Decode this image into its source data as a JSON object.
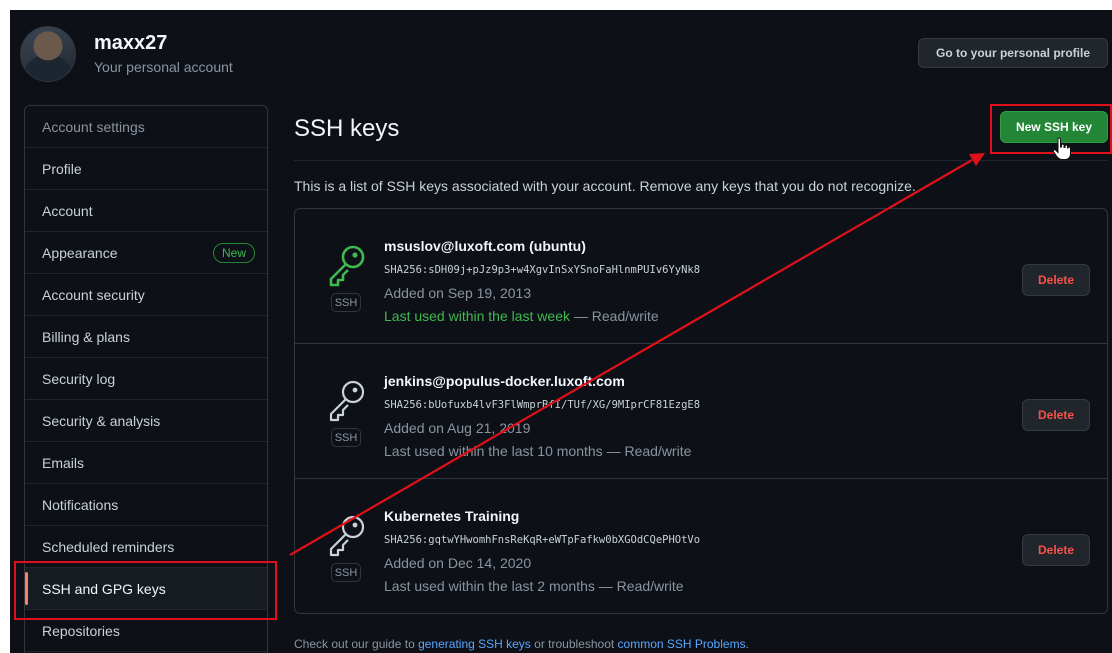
{
  "header": {
    "username": "maxx27",
    "account_sub": "Your personal account",
    "profile_button": "Go to your personal profile"
  },
  "sidebar": {
    "items": [
      {
        "label": "Account settings",
        "type": "heading"
      },
      {
        "label": "Profile"
      },
      {
        "label": "Account"
      },
      {
        "label": "Appearance",
        "badge": "New"
      },
      {
        "label": "Account security"
      },
      {
        "label": "Billing & plans"
      },
      {
        "label": "Security log"
      },
      {
        "label": "Security & analysis"
      },
      {
        "label": "Emails"
      },
      {
        "label": "Notifications"
      },
      {
        "label": "Scheduled reminders"
      },
      {
        "label": "SSH and GPG keys",
        "selected": true
      },
      {
        "label": "Repositories"
      }
    ]
  },
  "main": {
    "title": "SSH keys",
    "new_key_button": "New SSH key",
    "intro": "This is a list of SSH keys associated with your account. Remove any keys that you do not recognize.",
    "keys": [
      {
        "title": "msuslov@luxoft.com (ubuntu)",
        "fingerprint": "SHA256:sDH09j+pJz9p3+w4XgvInSxYSnoFaHlnmPUIv6YyNk8",
        "added": "Added on Sep 19, 2013",
        "used_recent": "Last used within the last week",
        "used_suffix": " — Read/write",
        "tag": "SSH",
        "delete_label": "Delete",
        "active": true
      },
      {
        "title": "jenkins@populus-docker.luxoft.com",
        "fingerprint": "SHA256:bUofuxb4lvF3FlWmprBfI/TUf/XG/9MIprCF81EzgE8",
        "added": "Added on Aug 21, 2019",
        "used_recent": "",
        "used_suffix": "Last used within the last 10 months — Read/write",
        "tag": "SSH",
        "delete_label": "Delete",
        "active": false
      },
      {
        "title": "Kubernetes Training",
        "fingerprint": "SHA256:gqtwYHwomhFnsReKqR+eWTpFafkw0bXGOdCQePHOtVo",
        "added": "Added on Dec 14, 2020",
        "used_recent": "",
        "used_suffix": "Last used within the last 2 months — Read/write",
        "tag": "SSH",
        "delete_label": "Delete",
        "active": false
      }
    ],
    "footer": {
      "prefix": "Check out our guide to ",
      "link1": "generating SSH keys",
      "middle": " or troubleshoot ",
      "link2": "common SSH Problems",
      "suffix": "."
    }
  },
  "colors": {
    "background": "#0d1117",
    "accent_green": "#238636",
    "link_blue": "#58a6ff",
    "danger_red": "#f85149",
    "annotation_red": "#e0101a"
  }
}
